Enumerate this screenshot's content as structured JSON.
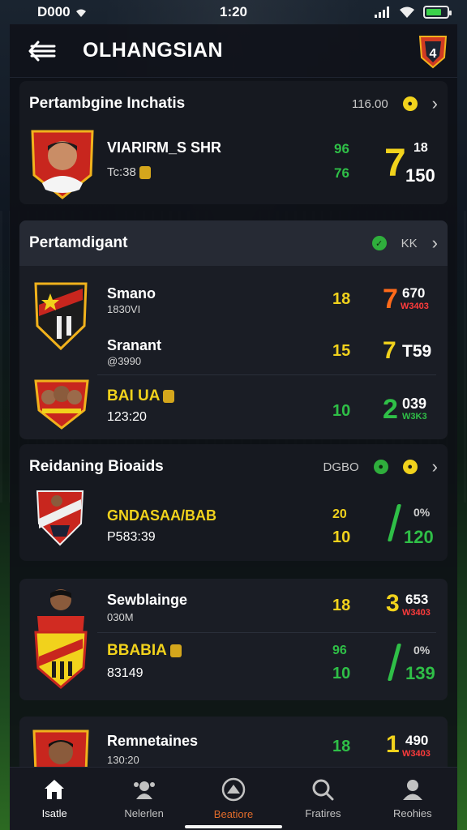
{
  "status": {
    "left": "D000",
    "time": "1:20"
  },
  "app": {
    "title": "OLHANGSIAN"
  },
  "section1": {
    "title": "Pertambgine Inchatis",
    "meta": "116.00",
    "player": {
      "name": "VIARIRM_S SHR",
      "sub": "Tc:38",
      "stat_top": "96",
      "stat_bottom": "76",
      "big": "7",
      "side_top": "18",
      "side_bottom": "150"
    }
  },
  "section2": {
    "title": "Pertamdigant",
    "meta": "KK",
    "rows": [
      {
        "name": "Smano",
        "sub": "1830VI",
        "stat": "18",
        "big": "7",
        "side": "670",
        "tiny": "W3403"
      },
      {
        "name": "Sranant",
        "sub": "@3990",
        "stat": "15",
        "big": "7",
        "side": "T59",
        "tiny": ""
      },
      {
        "name": "BAI UA",
        "sub": "123:20",
        "stat": "10",
        "big": "2",
        "side": "039",
        "tiny": "W3K3"
      }
    ]
  },
  "section3": {
    "title": "Reidaning Bioaids",
    "meta": "DGBO",
    "player": {
      "name": "GNDASAA/BAB",
      "sub": "P583:39",
      "stat_top": "20",
      "stat_bottom": "10",
      "side_top": "0%",
      "side_bottom": "120"
    }
  },
  "section4": {
    "rows": [
      {
        "name": "Sewblainge",
        "sub": "030M",
        "stat": "18",
        "big": "3",
        "side": "653",
        "tiny": "W3403"
      },
      {
        "name": "BBABIA",
        "sub": "83149",
        "stat_top": "96",
        "stat_bottom": "10",
        "side_top": "0%",
        "side_bottom": "139"
      }
    ]
  },
  "section5": {
    "player": {
      "name": "Remnetaines",
      "sub": "130:20",
      "stat": "18",
      "big": "1",
      "side": "490",
      "tiny": "W3403"
    }
  },
  "tabs": [
    {
      "label": "Isatle",
      "icon": "home-icon"
    },
    {
      "label": "Nelerlen",
      "icon": "team-icon"
    },
    {
      "label": "Beatiore",
      "icon": "ball-icon"
    },
    {
      "label": "Fratires",
      "icon": "search-icon"
    },
    {
      "label": "Reohies",
      "icon": "profile-icon"
    }
  ],
  "colors": {
    "accent_yellow": "#f1d21c",
    "accent_green": "#2fbf47",
    "accent_orange": "#ff6a1a",
    "card": "#1a1d25"
  }
}
